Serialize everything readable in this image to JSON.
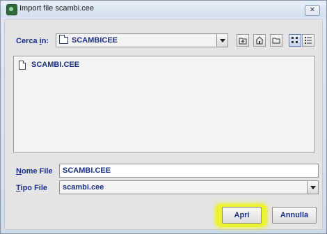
{
  "window": {
    "title": "Import file scambi.cee",
    "close_glyph": "✕"
  },
  "lookin": {
    "label_prefix": "Cerca ",
    "label_mnemonic": "i",
    "label_suffix": "n:",
    "value": "SCAMBICEE",
    "icon": "folder-icon"
  },
  "toolbar": {
    "buttons": [
      {
        "name": "up-one-level-icon"
      },
      {
        "name": "home-icon"
      },
      {
        "name": "new-folder-icon"
      },
      {
        "name": "list-view-icon"
      },
      {
        "name": "details-view-icon"
      }
    ]
  },
  "filelist": {
    "items": [
      {
        "name": "SCAMBI.CEE",
        "icon": "file-icon"
      }
    ]
  },
  "filename": {
    "label_mnemonic": "N",
    "label_rest": "ome File",
    "value": "SCAMBI.CEE"
  },
  "filetype": {
    "label_mnemonic": "T",
    "label_rest": "ipo File",
    "value": "scambi.cee"
  },
  "buttons": {
    "open": "Apri",
    "cancel": "Annulla"
  },
  "colors": {
    "label_text": "#1a2f86",
    "highlight": "#eef514",
    "panel": "#e4e4e4"
  }
}
